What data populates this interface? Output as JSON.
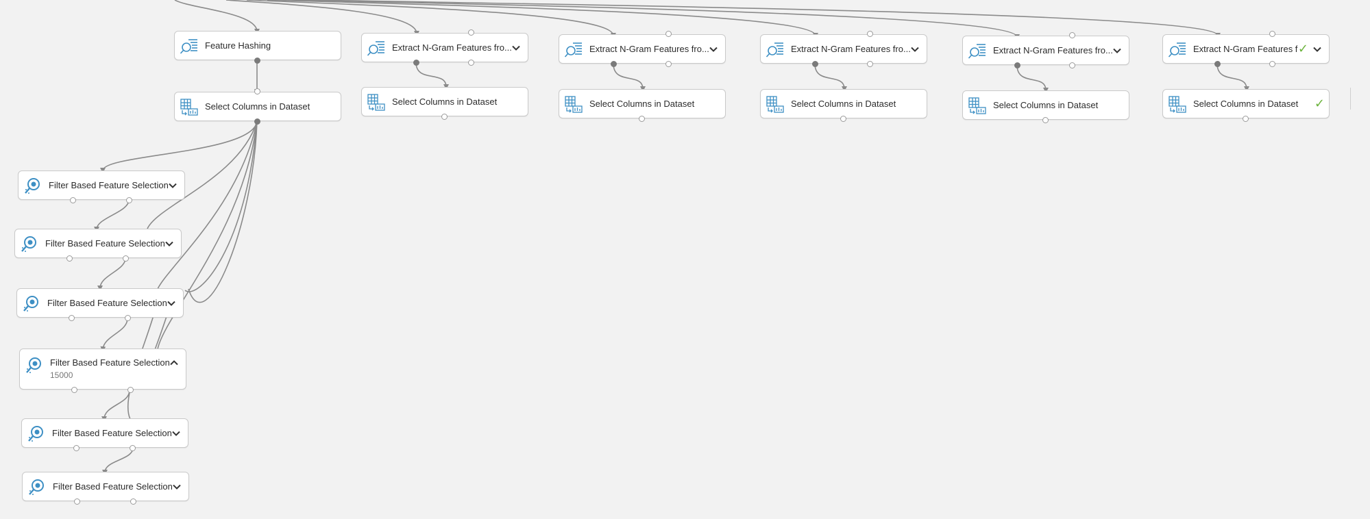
{
  "colors": {
    "canvas": "#f2f2f2",
    "module_border": "#c9c9c9",
    "wire": "#8a8a8a",
    "icon_blue": "#3d8fc4",
    "success_check": "#6bb33c"
  },
  "modules": [
    {
      "id": "fh",
      "label": "Feature Hashing",
      "icon": "feature-hashing-icon",
      "has_chevron": false,
      "has_check": false
    },
    {
      "id": "sc0",
      "label": "Select Columns in Dataset",
      "icon": "select-columns-icon",
      "has_chevron": false,
      "has_check": false
    },
    {
      "id": "ng1",
      "label": "Extract N-Gram Features fro...",
      "icon": "ngram-icon",
      "has_chevron": true,
      "has_check": false
    },
    {
      "id": "ng2",
      "label": "Extract N-Gram Features fro...",
      "icon": "ngram-icon",
      "has_chevron": true,
      "has_check": false
    },
    {
      "id": "ng3",
      "label": "Extract N-Gram Features fro...",
      "icon": "ngram-icon",
      "has_chevron": true,
      "has_check": false
    },
    {
      "id": "ng4",
      "label": "Extract N-Gram Features fro...",
      "icon": "ngram-icon",
      "has_chevron": true,
      "has_check": false
    },
    {
      "id": "ng5",
      "label": "Extract N-Gram Features fro...",
      "icon": "ngram-icon",
      "has_chevron": true,
      "has_check": true
    },
    {
      "id": "sc1",
      "label": "Select Columns in Dataset",
      "icon": "select-columns-icon",
      "has_chevron": false,
      "has_check": false
    },
    {
      "id": "sc2",
      "label": "Select Columns in Dataset",
      "icon": "select-columns-icon",
      "has_chevron": false,
      "has_check": false
    },
    {
      "id": "sc3",
      "label": "Select Columns in Dataset",
      "icon": "select-columns-icon",
      "has_chevron": false,
      "has_check": false
    },
    {
      "id": "sc4",
      "label": "Select Columns in Dataset",
      "icon": "select-columns-icon",
      "has_chevron": false,
      "has_check": false
    },
    {
      "id": "sc5",
      "label": "Select Columns in Dataset",
      "icon": "select-columns-icon",
      "has_chevron": false,
      "has_check": true
    },
    {
      "id": "f1",
      "label": "Filter Based Feature Selection",
      "icon": "filter-feature-selection-icon",
      "has_chevron": true,
      "chevron": "down",
      "has_check": false
    },
    {
      "id": "f2",
      "label": "Filter Based Feature Selection",
      "icon": "filter-feature-selection-icon",
      "has_chevron": true,
      "chevron": "down",
      "has_check": false
    },
    {
      "id": "f3",
      "label": "Filter Based Feature Selection",
      "icon": "filter-feature-selection-icon",
      "has_chevron": true,
      "chevron": "down",
      "has_check": false
    },
    {
      "id": "f4",
      "label": "Filter Based Feature Selection",
      "icon": "filter-feature-selection-icon",
      "has_chevron": true,
      "chevron": "up",
      "param": "15000",
      "has_check": false
    },
    {
      "id": "f5",
      "label": "Filter Based Feature Selection",
      "icon": "filter-feature-selection-icon",
      "has_chevron": true,
      "chevron": "down",
      "has_check": false
    },
    {
      "id": "f6",
      "label": "Filter Based Feature Selection",
      "icon": "filter-feature-selection-icon",
      "has_chevron": true,
      "chevron": "down",
      "has_check": false
    }
  ]
}
